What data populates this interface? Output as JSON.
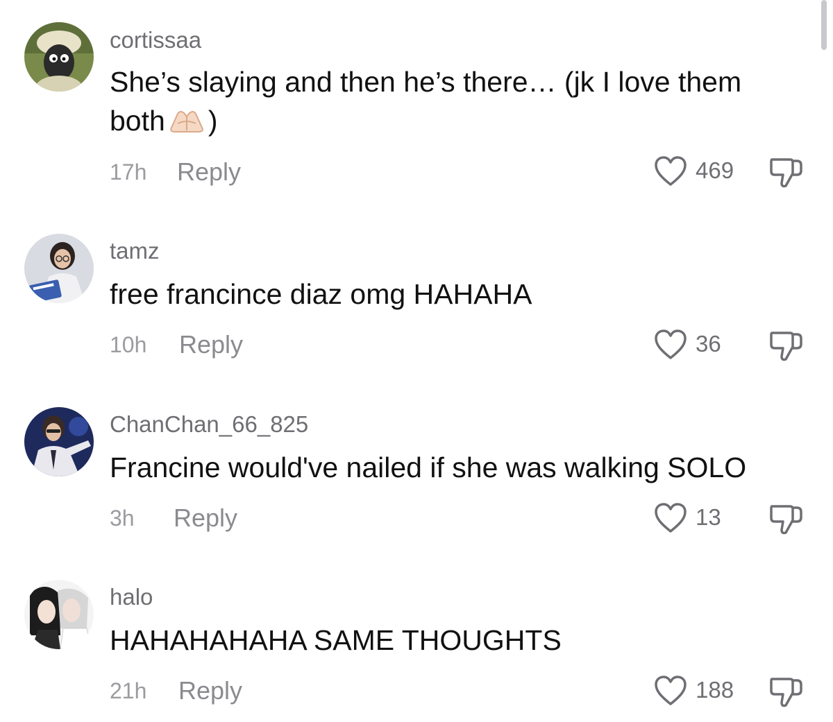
{
  "comments": [
    {
      "username": "cortissaa",
      "text_before": "She’s slaying and then he’s there… (jk I love them both",
      "emoji": "heart-hands-emoji",
      "text_after": ")",
      "time": "17h",
      "reply_label": "Reply",
      "likes": "469"
    },
    {
      "username": "tamz",
      "text": "free francince diaz omg HAHAHA",
      "time": "10h",
      "reply_label": "Reply",
      "likes": "36"
    },
    {
      "username": "ChanChan_66_825",
      "text": "Francine would've nailed if she was walking SOLO",
      "time": "3h",
      "reply_label": "Reply",
      "likes": "13"
    },
    {
      "username": "halo",
      "text": "HAHAHAHAHA SAME THOUGHTS",
      "time": "21h",
      "reply_label": "Reply",
      "likes": "188"
    }
  ],
  "icons": {
    "like": "heart-outline-icon",
    "dislike": "thumbs-down-icon"
  },
  "colors": {
    "username": "#6e6e73",
    "body": "#111111",
    "meta": "#9b9ba0"
  }
}
